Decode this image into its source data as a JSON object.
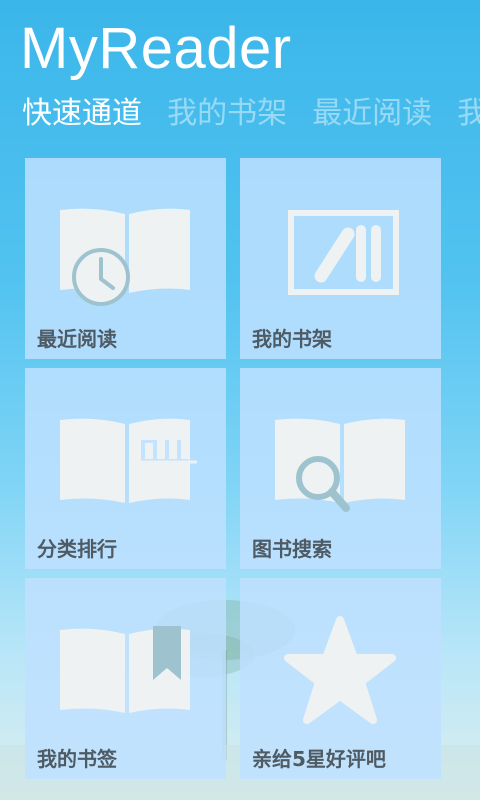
{
  "app": {
    "title": "MyReader"
  },
  "tabs": [
    {
      "label": "快速通道",
      "active": true
    },
    {
      "label": "我的书架",
      "active": false
    },
    {
      "label": "最近阅读",
      "active": false
    },
    {
      "label": "我",
      "active": false
    }
  ],
  "tiles": [
    {
      "label": "最近阅读",
      "icon": "book-clock-icon"
    },
    {
      "label": "我的书架",
      "icon": "bookshelf-icon"
    },
    {
      "label": "分类排行",
      "icon": "book-chart-icon"
    },
    {
      "label": "图书搜索",
      "icon": "book-search-icon"
    },
    {
      "label": "我的书签",
      "icon": "bookmark-icon"
    },
    {
      "label": "亲给5星好评吧",
      "icon": "star-icon"
    }
  ],
  "colors": {
    "accent_icon": "#9ec3cf",
    "tile_bg": "#bee1ff",
    "label_text": "#4f5b64"
  }
}
